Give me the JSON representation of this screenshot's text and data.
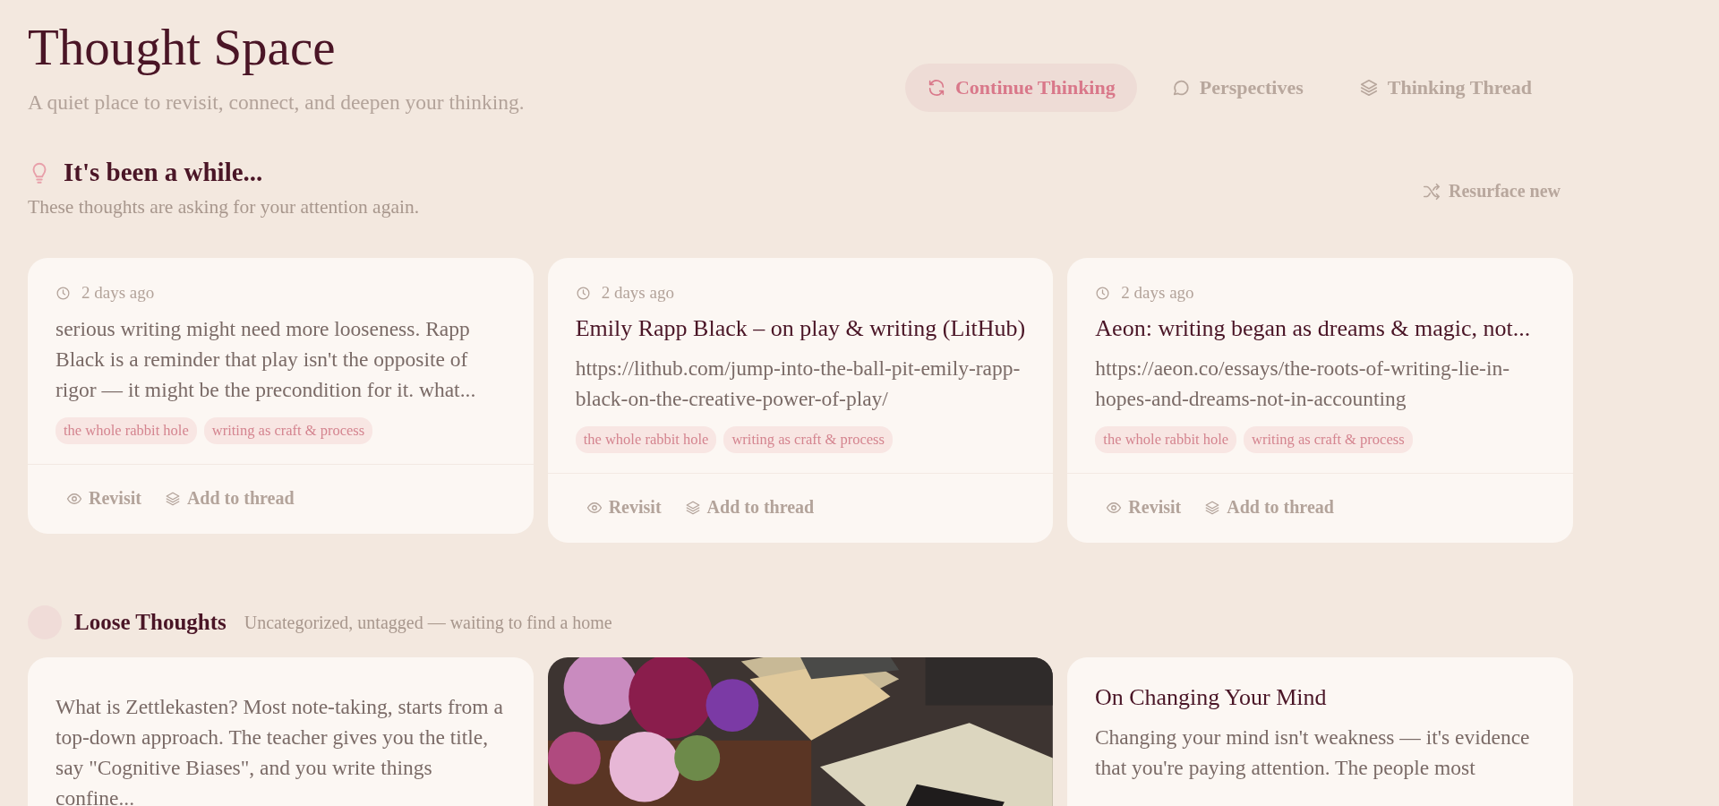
{
  "header": {
    "title": "Thought Space",
    "subtitle": "A quiet place to revisit, connect, and deepen your thinking."
  },
  "nav": [
    {
      "label": "Continue Thinking",
      "selected": true
    },
    {
      "label": "Perspectives",
      "selected": false
    },
    {
      "label": "Thinking Thread",
      "selected": false
    }
  ],
  "resurface": {
    "title": "It's been a while...",
    "subtitle": "These thoughts are asking for your attention again.",
    "action": "Resurface new",
    "cards": [
      {
        "kind": "note",
        "time": "2 days ago",
        "body": "serious writing might need more looseness. Rapp Black is a reminder that play isn't the opposite of rigor — it might be the precondition for it. what...",
        "tags": [
          "the whole rabbit hole",
          "writing as craft & process"
        ],
        "actions": [
          "Revisit",
          "Add to thread"
        ]
      },
      {
        "kind": "link",
        "time": "2 days ago",
        "title": "Emily Rapp Black – on play & writing (LitHub)",
        "body": "https://lithub.com/jump-into-the-ball-pit-emily-rapp-black-on-the-creative-power-of-play/",
        "tags": [
          "the whole rabbit hole",
          "writing as craft & process"
        ],
        "actions": [
          "Revisit",
          "Add to thread"
        ]
      },
      {
        "kind": "link",
        "time": "2 days ago",
        "title": "Aeon: writing began as dreams & magic, not...",
        "body": "https://aeon.co/essays/the-roots-of-writing-lie-in-hopes-and-dreams-not-in-accounting",
        "tags": [
          "the whole rabbit hole",
          "writing as craft & process"
        ],
        "actions": [
          "Revisit",
          "Add to thread"
        ]
      }
    ]
  },
  "loose": {
    "title": "Loose Thoughts",
    "subtitle": "Uncategorized, untagged — waiting to find a home",
    "cards": [
      {
        "kind": "note",
        "body": "What is Zettlekasten? Most note-taking, starts from a top-down approach. The teacher gives you the title, say \"Cognitive Biases\", and you write things confine..."
      },
      {
        "kind": "picture"
      },
      {
        "kind": "titled",
        "title": "On Changing Your Mind",
        "body": "Changing your mind isn't weakness — it's evidence that you're paying attention. The people most"
      }
    ]
  }
}
